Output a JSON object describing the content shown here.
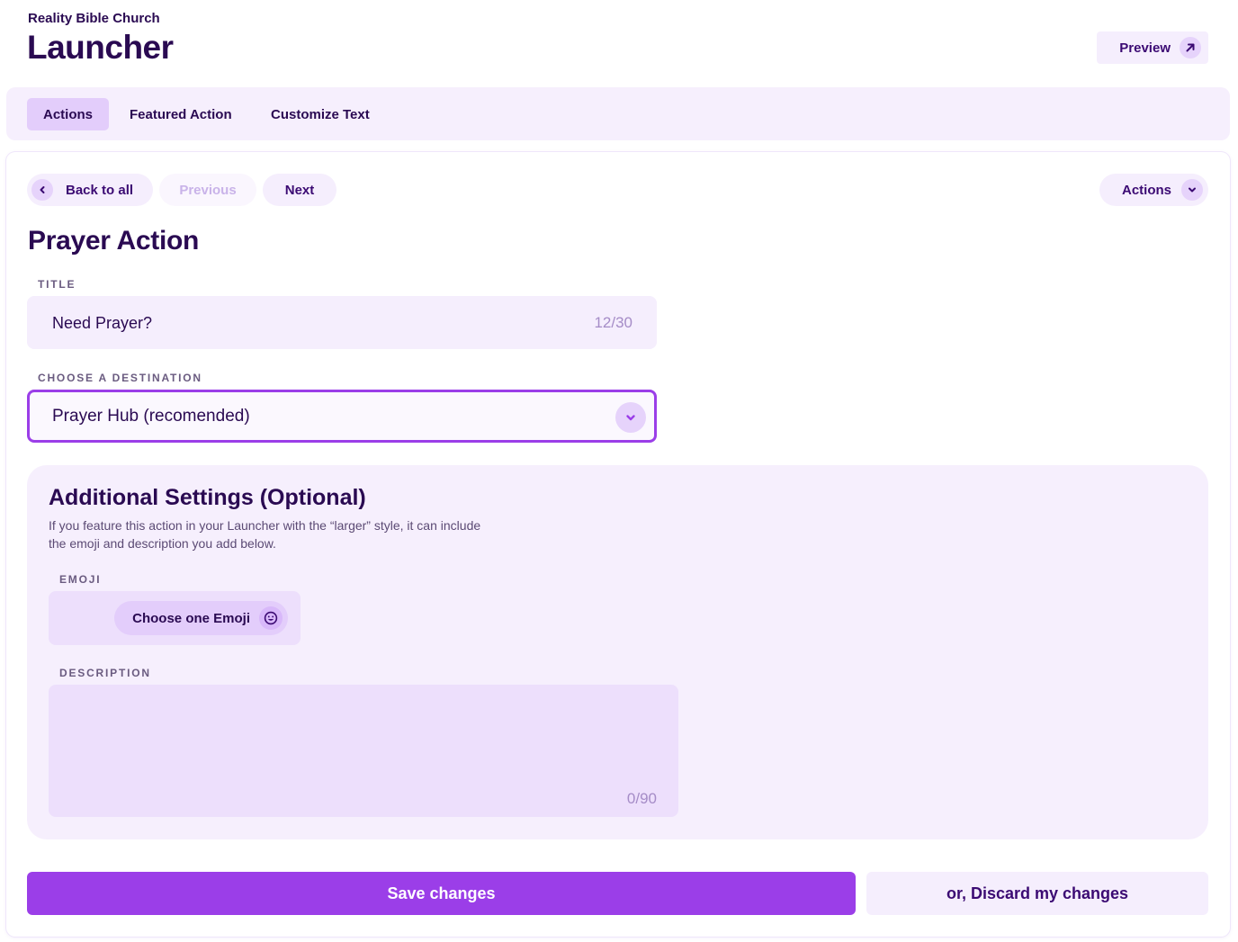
{
  "header": {
    "org_name": "Reality Bible Church",
    "page_title": "Launcher",
    "preview_label": "Preview"
  },
  "tabs": [
    {
      "label": "Actions",
      "active": true
    },
    {
      "label": "Featured Action",
      "active": false
    },
    {
      "label": "Customize Text",
      "active": false
    }
  ],
  "nav": {
    "back_label": "Back to all",
    "previous_label": "Previous",
    "next_label": "Next",
    "actions_label": "Actions"
  },
  "form": {
    "section_title": "Prayer Action",
    "title_label": "TITLE",
    "title_value": "Need Prayer?",
    "title_count": "12/30",
    "destination_label": "CHOOSE A DESTINATION",
    "destination_value": "Prayer Hub (recomended)"
  },
  "additional": {
    "heading": "Additional Settings (Optional)",
    "description": "If you feature this action in your Launcher with the “larger” style, it can include the emoji and description you add below.",
    "emoji_label": "EMOJI",
    "emoji_button": "Choose one Emoji",
    "description_label": "DESCRIPTION",
    "description_value": "",
    "description_count": "0/90"
  },
  "footer": {
    "save_label": "Save changes",
    "discard_label": "or, Discard my changes"
  },
  "colors": {
    "primary": "#9b3ee8",
    "text_dark": "#2a0a52",
    "tint_light": "#f6effd",
    "tint_medium": "#e3cdfb"
  },
  "icons": [
    "arrow-up-right-icon",
    "chevron-left-icon",
    "chevron-down-icon",
    "smiley-icon"
  ]
}
